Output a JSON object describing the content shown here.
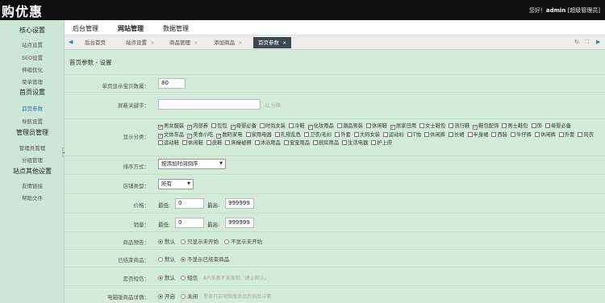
{
  "header": {
    "logo": "购优惠",
    "greeting": "您好！",
    "username": "admin",
    "role_link": "[超级管理员]"
  },
  "topnav": [
    "后台管理",
    "网站管理",
    "数据管理"
  ],
  "sidebar": [
    {
      "label": "核心设置",
      "kind": "h"
    },
    {
      "label": "站点设置",
      "kind": "i"
    },
    {
      "label": "SEO设置",
      "kind": "i"
    },
    {
      "label": "伸缩优化",
      "kind": "i"
    },
    {
      "label": "菜单管理",
      "kind": "i"
    },
    {
      "label": "首页设置",
      "kind": "h"
    },
    {
      "label": "首页参数",
      "kind": "i"
    },
    {
      "label": "导航设置",
      "kind": "i"
    },
    {
      "label": "管理员管理",
      "kind": "h"
    },
    {
      "label": "管理员管理",
      "kind": "i"
    },
    {
      "label": "分组管理",
      "kind": "i"
    },
    {
      "label": "站点其他设置",
      "kind": "h"
    },
    {
      "label": "友情链接",
      "kind": "i"
    },
    {
      "label": "帮助文件",
      "kind": "i"
    }
  ],
  "tabs": [
    {
      "label": "后台首页",
      "close": ""
    },
    {
      "label": "站点设置",
      "close": "×"
    },
    {
      "label": "商品管理",
      "close": "×"
    },
    {
      "label": "添加商品",
      "close": "×"
    },
    {
      "label": "首页参数",
      "close": "×"
    }
  ],
  "page_title": "首页参数 - 设置",
  "form": {
    "per_page_label": "单页显示宝贝数量：",
    "per_page_value": "80",
    "keyword_label": "屏蔽关键字：",
    "keyword_value": "",
    "keyword_hint": "以,分隔",
    "cat_label": "显示分类：",
    "categories": [
      {
        "name": "男女服装",
        "checked": true
      },
      {
        "name": "内部券",
        "checked": true
      },
      {
        "name": "包包",
        "checked": false
      },
      {
        "name": "母婴必备",
        "checked": true
      },
      {
        "name": "时尚女装",
        "checked": false
      },
      {
        "name": "冷鞋",
        "checked": false
      },
      {
        "name": "化妆用品",
        "checked": true
      },
      {
        "name": "潮品男装",
        "checked": false
      },
      {
        "name": "休闲鞋",
        "checked": false
      },
      {
        "name": "居家日用",
        "checked": true
      },
      {
        "name": "女士鞋包",
        "checked": false
      },
      {
        "name": "流行鞋",
        "checked": false
      },
      {
        "name": "鞋包配饰",
        "checked": true
      },
      {
        "name": "男士鞋包",
        "checked": false
      },
      {
        "name": "饰",
        "checked": false
      },
      {
        "name": "母婴必备",
        "checked": false
      },
      {
        "name": "文体车品",
        "checked": true
      },
      {
        "name": "美食小吃",
        "checked": true
      },
      {
        "name": "数码家电",
        "checked": true
      },
      {
        "name": "家用电器",
        "checked": false
      },
      {
        "name": "孔规乱色",
        "checked": false
      },
      {
        "name": "卫衣/毛衫",
        "checked": false
      },
      {
        "name": "外套",
        "checked": false
      },
      {
        "name": "大码女装",
        "checked": false
      },
      {
        "name": "运动衫",
        "checked": false
      },
      {
        "name": "T恤",
        "checked": false
      },
      {
        "name": "休闲裤",
        "checked": false
      },
      {
        "name": "长裙",
        "checked": false
      },
      {
        "name": "半身裙",
        "checked": false
      },
      {
        "name": "西装",
        "checked": false
      },
      {
        "name": "牛仔裤",
        "checked": false
      },
      {
        "name": "休闲裤",
        "checked": false
      },
      {
        "name": "外套",
        "checked": false
      },
      {
        "name": "风衣",
        "checked": false
      },
      {
        "name": "运动鞋",
        "checked": false
      },
      {
        "name": "休闲鞋",
        "checked": false
      },
      {
        "name": "皮鞋",
        "checked": false
      },
      {
        "name": "床幔被褥",
        "checked": false
      },
      {
        "name": "沐浴用品",
        "checked": false
      },
      {
        "name": "宝宝用品",
        "checked": false
      },
      {
        "name": "厨房用品",
        "checked": false
      },
      {
        "name": "生活电器",
        "checked": false
      },
      {
        "name": "护上府",
        "checked": false
      }
    ],
    "sort_label": "排序方式：",
    "sort_value": "按添加时间倒序",
    "shop_label": "店铺类型：",
    "shop_value": "所有",
    "price_label": "价格：",
    "price_min_label": "最低:",
    "price_min": "0",
    "price_max_label": "最高:",
    "price_max": "999999",
    "sales_label": "销量：",
    "sales_min_label": "最低:",
    "sales_min": "0",
    "sales_max_label": "最高:",
    "sales_max": "999999",
    "preview_label": "商品预告：",
    "preview_options": [
      "默认",
      "只显示未开始",
      "不显示未开始"
    ],
    "ended_label": "已结束商品：",
    "ended_options": [
      "默认",
      "不显示已结束商品"
    ],
    "sms_label": "是否短信：",
    "sms_options": [
      "默认",
      "短信"
    ],
    "sms_hint": "API采集不被限制，建议默认。",
    "pc_label": "电脑版商品详情：",
    "pc_options": [
      "开启",
      "关闭"
    ],
    "pc_hint": "是否开启电脑版商品的商品详情"
  },
  "colors": {
    "sidebar_bg": "#cde7d6",
    "content_bg": "#d3ecd9",
    "topbar_bg": "#0f0f0f",
    "active_tab": "#3d4750",
    "active_link": "#2a7abf"
  }
}
